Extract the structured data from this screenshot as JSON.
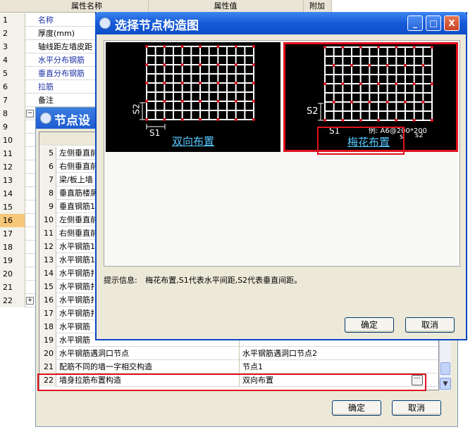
{
  "background_grid": {
    "headers": [
      "属性名称",
      "属性值",
      "附加"
    ],
    "rows": [
      {
        "num": "1",
        "name": "名称",
        "blue": true
      },
      {
        "num": "2",
        "name": "厚度(mm)",
        "blue": false
      },
      {
        "num": "3",
        "name": "轴线距左墙皮距",
        "blue": false
      },
      {
        "num": "4",
        "name": "水平分布钢筋",
        "blue": true
      },
      {
        "num": "5",
        "name": "垂直分布钢筋",
        "blue": true
      },
      {
        "num": "6",
        "name": "拉筋",
        "blue": true
      },
      {
        "num": "7",
        "name": "备注",
        "blue": false
      },
      {
        "num": "8",
        "name": "",
        "blue": false
      },
      {
        "num": "9",
        "name": "",
        "blue": false
      },
      {
        "num": "10",
        "name": "",
        "blue": false
      },
      {
        "num": "11",
        "name": "",
        "blue": false
      },
      {
        "num": "12",
        "name": "",
        "blue": false
      },
      {
        "num": "13",
        "name": "",
        "blue": false
      },
      {
        "num": "14",
        "name": "",
        "blue": false
      },
      {
        "num": "15",
        "name": "",
        "blue": false
      },
      {
        "num": "16",
        "name": "",
        "blue": false
      },
      {
        "num": "17",
        "name": "",
        "blue": false
      },
      {
        "num": "18",
        "name": "",
        "blue": false
      },
      {
        "num": "19",
        "name": "",
        "blue": false
      },
      {
        "num": "20",
        "name": "",
        "blue": false
      },
      {
        "num": "21",
        "name": "",
        "blue": false
      },
      {
        "num": "22",
        "name": "",
        "blue": false
      }
    ],
    "selected_row": "16"
  },
  "node_dialog": {
    "title": "节点设",
    "rows": [
      {
        "num": "5",
        "name": "左侧垂直前",
        "value": ""
      },
      {
        "num": "6",
        "name": "右侧垂直前",
        "value": ""
      },
      {
        "num": "7",
        "name": "梁/板上墙",
        "value": ""
      },
      {
        "num": "8",
        "name": "垂直筋楼屑",
        "value": ""
      },
      {
        "num": "9",
        "name": "垂直钢筋1",
        "value": ""
      },
      {
        "num": "10",
        "name": "左侧垂直前",
        "value": ""
      },
      {
        "num": "11",
        "name": "右侧垂直前",
        "value": ""
      },
      {
        "num": "12",
        "name": "水平钢筋1",
        "value": ""
      },
      {
        "num": "13",
        "name": "水平钢筋1",
        "value": ""
      },
      {
        "num": "14",
        "name": "水平钢筋扌",
        "value": ""
      },
      {
        "num": "15",
        "name": "水平钢筋扌",
        "value": ""
      },
      {
        "num": "16",
        "name": "水平钢筋扌",
        "value": ""
      },
      {
        "num": "17",
        "name": "水平钢筋扌",
        "value": ""
      },
      {
        "num": "18",
        "name": "水平钢筋",
        "value": ""
      },
      {
        "num": "19",
        "name": "水平钢筋",
        "value": ""
      },
      {
        "num": "20",
        "name": "水平钢筋遇洞口节点",
        "value": "水平钢筋遇洞口节点2"
      },
      {
        "num": "21",
        "name": "配筋不同的墙一字相交构造",
        "value": "节点1"
      },
      {
        "num": "22",
        "name": "墙身拉筋布置构造",
        "value": "双向布置"
      }
    ],
    "ellipsis": "···",
    "ok_label": "确定",
    "cancel_label": "取消",
    "scroll_down_glyph": "▼"
  },
  "select_dialog": {
    "title": "选择节点构造图",
    "titlebar_buttons": {
      "minimize": "_",
      "maximize": "□",
      "close": "X"
    },
    "options": [
      {
        "label": "双向布置",
        "s1": "S1",
        "s2": "S2",
        "selected": false
      },
      {
        "label": "梅花布置",
        "s1": "S1",
        "s2": "S2",
        "note": "例: A6@200*200",
        "s_small": "s",
        "s2_small": "s2",
        "selected": true
      }
    ],
    "hint_label": "提示信息:",
    "hint_text": "梅花布置,S1代表水平间距,S2代表垂直间距。",
    "ok_label": "确定",
    "cancel_label": "取消"
  },
  "colors": {
    "highlight_red": "#e0121e",
    "title_blue": "#1659d8",
    "link_cyan": "#58c8ff"
  }
}
